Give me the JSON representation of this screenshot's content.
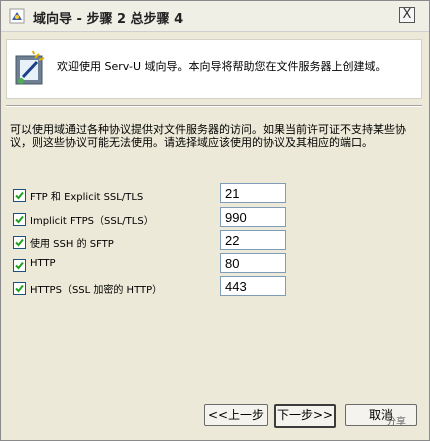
{
  "window": {
    "title": "域向导 - 步骤 2 总步骤 4",
    "close_label": "X"
  },
  "welcome": {
    "message": "欢迎使用 Serv-U 域向导。本向导将帮助您在文件服务器上创建域。"
  },
  "description": "可以使用域通过各种协议提供对文件服务器的访问。如果当前许可证不支持某些协议，则这些协议可能无法使用。请选择域应该使用的协议及其相应的端口。",
  "protocols": [
    {
      "label": "FTP 和 Explicit SSL/TLS",
      "checked": true,
      "port": "21"
    },
    {
      "label": "Implicit FTPS（SSL/TLS）",
      "checked": true,
      "port": "990"
    },
    {
      "label": "使用 SSH 的 SFTP",
      "checked": true,
      "port": "22"
    },
    {
      "label": "HTTP",
      "checked": true,
      "port": "80"
    },
    {
      "label": "HTTPS（SSL 加密的 HTTP）",
      "checked": true,
      "port": "443"
    }
  ],
  "buttons": {
    "back": "<<上一步",
    "next": "下一步>>",
    "cancel": "取消"
  },
  "watermark": "分享"
}
